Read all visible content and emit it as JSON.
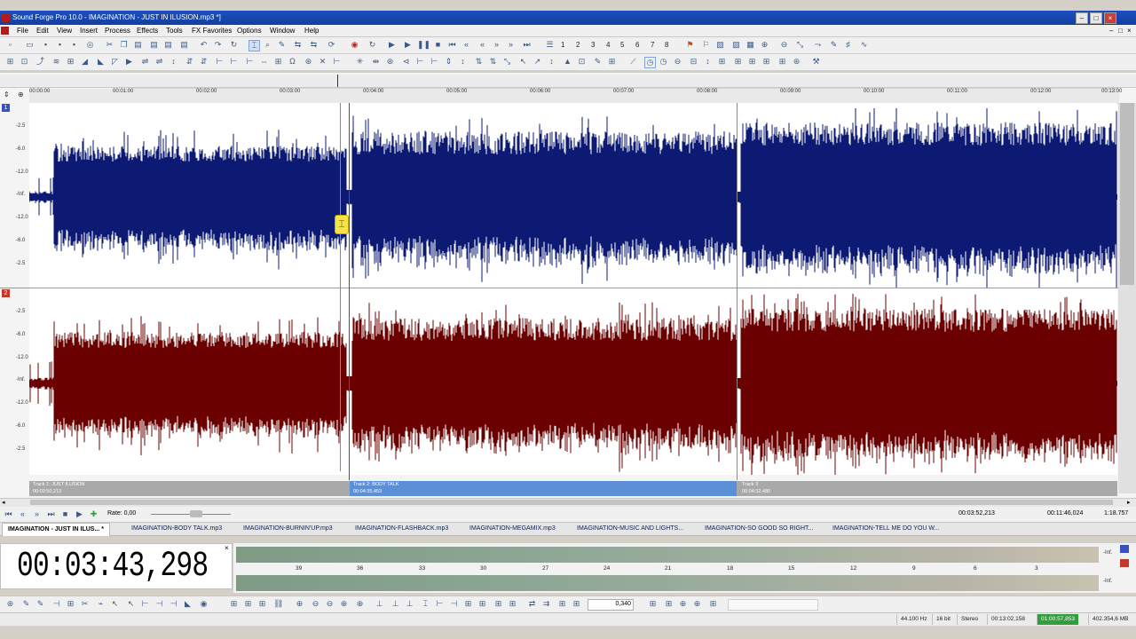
{
  "window": {
    "title": "Sound Forge Pro 10.0 - IMAGINATION - JUST IN ILUSION.mp3 *]"
  },
  "menu": [
    "File",
    "Edit",
    "View",
    "Insert",
    "Process",
    "Effects",
    "Tools",
    "FX Favorites",
    "Options",
    "Window",
    "Help"
  ],
  "toolbar": {
    "numbers": [
      "1",
      "2",
      "3",
      "4",
      "5",
      "6",
      "7",
      "8"
    ]
  },
  "ruler": {
    "ticks": [
      "00:00:00",
      "00:01:00",
      "00:02:00",
      "00:03:00",
      "00:04:00",
      "00:05:00",
      "00:06:00",
      "00:07:00",
      "00:08:00",
      "00:09:00",
      "00:10:00",
      "00:11:00",
      "00:12:00",
      "00:13:00"
    ]
  },
  "channels": {
    "ch1_label": "1",
    "ch2_label": "2",
    "db_scale": [
      "-2.5",
      "-6.0",
      "-12.0",
      "-Inf.",
      "-12.0",
      "-6.0",
      "-2.5"
    ],
    "ch1_color": "#0c1a73",
    "ch2_color": "#6b0000"
  },
  "regions": [
    {
      "name": "Track 1: JUST ILUSION",
      "time": "00:03:50,213"
    },
    {
      "name": "Track 2: BODY TALK",
      "time": "00:04:35,453"
    },
    {
      "name": "Track 3",
      "time": "00:04:32,480"
    }
  ],
  "transport": {
    "rate_label": "Rate: 0,00",
    "sel_start": "00:03:52,213",
    "sel_end": "00:11:46,024",
    "sel_len": "1:18.757"
  },
  "tabs": [
    "IMAGINATION - JUST IN ILUS... *",
    "IMAGINATION-BODY TALK.mp3",
    "IMAGINATION-BURNIN'UP.mp3",
    "IMAGINATION-FLASHBACK.mp3",
    "IMAGINATION-MEGAMIX.mp3",
    "IMAGINATION-MUSIC AND LIGHTS...",
    "IMAGINATION-SO GOOD SO RIGHT...",
    "IMAGINATION-TELL ME DO YOU W..."
  ],
  "time_display": "00:03:43,298",
  "meter": {
    "labels": [
      "39",
      "36",
      "33",
      "30",
      "27",
      "24",
      "21",
      "18",
      "15",
      "12",
      "9",
      "6",
      "3"
    ],
    "clip_top": "-Inf.",
    "clip_bottom": "-Inf."
  },
  "bottom_toolbar": {
    "value": "0,340"
  },
  "status": {
    "sample_rate": "44.100 Hz",
    "bit_depth": "16 bit",
    "channels": "Stereo",
    "length": "00:13:02,158",
    "selection": "01:00:57,853",
    "free": "402.354,6 MB"
  },
  "colors": {
    "accent": "#1c4fbf",
    "region_active": "#5b8fd6",
    "region_inactive": "#a9a9a9"
  }
}
